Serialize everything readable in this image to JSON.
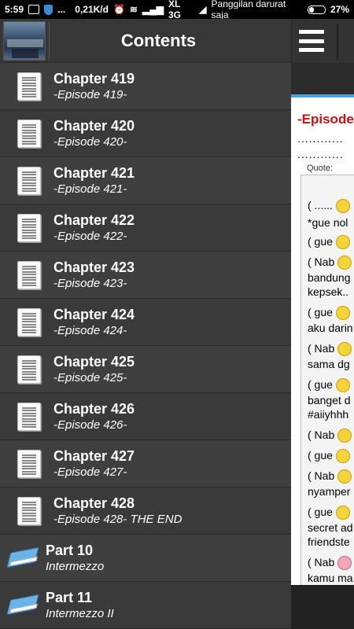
{
  "status_bar": {
    "time": "5:59",
    "dots": "...",
    "speed": "0,21K/d",
    "carrier": "XL 3G",
    "emergency": "Panggilan darurat saja",
    "battery": "27%"
  },
  "drawer": {
    "title": "Contents",
    "items": [
      {
        "title": "Chapter 419",
        "subtitle": "-Episode 419-",
        "icon": "document-icon"
      },
      {
        "title": "Chapter 420",
        "subtitle": "-Episode 420-",
        "icon": "document-icon"
      },
      {
        "title": "Chapter 421",
        "subtitle": "-Episode 421-",
        "icon": "document-icon"
      },
      {
        "title": "Chapter 422",
        "subtitle": "-Episode 422-",
        "icon": "document-icon"
      },
      {
        "title": "Chapter 423",
        "subtitle": "-Episode 423-",
        "icon": "document-icon"
      },
      {
        "title": "Chapter 424",
        "subtitle": "-Episode 424-",
        "icon": "document-icon"
      },
      {
        "title": "Chapter 425",
        "subtitle": "-Episode 425-",
        "icon": "document-icon"
      },
      {
        "title": "Chapter 426",
        "subtitle": "-Episode 426-",
        "icon": "document-icon"
      },
      {
        "title": "Chapter 427",
        "subtitle": "-Episode 427-",
        "icon": "document-icon"
      },
      {
        "title": "Chapter 428",
        "subtitle": "-Episode 428- THE END",
        "icon": "document-icon"
      },
      {
        "title": "Part 10",
        "subtitle": "Intermezzo",
        "icon": "book-icon"
      },
      {
        "title": "Part 11",
        "subtitle": "Intermezzo II",
        "icon": "book-icon"
      }
    ]
  },
  "content": {
    "episode_title": "-Episode",
    "dots1": "............",
    "dots2": "............",
    "quote_label": "Quote:",
    "lines": [
      "( ......",
      "*gue nol",
      "( gue",
      "( Nab",
      "bandung",
      "kepsek..",
      "( gue",
      "aku darin",
      "( Nab",
      "sama dg",
      "( gue",
      "banget d",
      "#aiiyhhh",
      "( Nab",
      "( gue",
      "( Nab",
      "nyamper",
      "( gue",
      "secret ad",
      "friendste",
      "( Nab",
      "kamu ma"
    ]
  },
  "colors": {
    "episode_title": "#d01010",
    "page_accent": "#4aa3df",
    "drawer_bg": "#3a3a3a"
  }
}
